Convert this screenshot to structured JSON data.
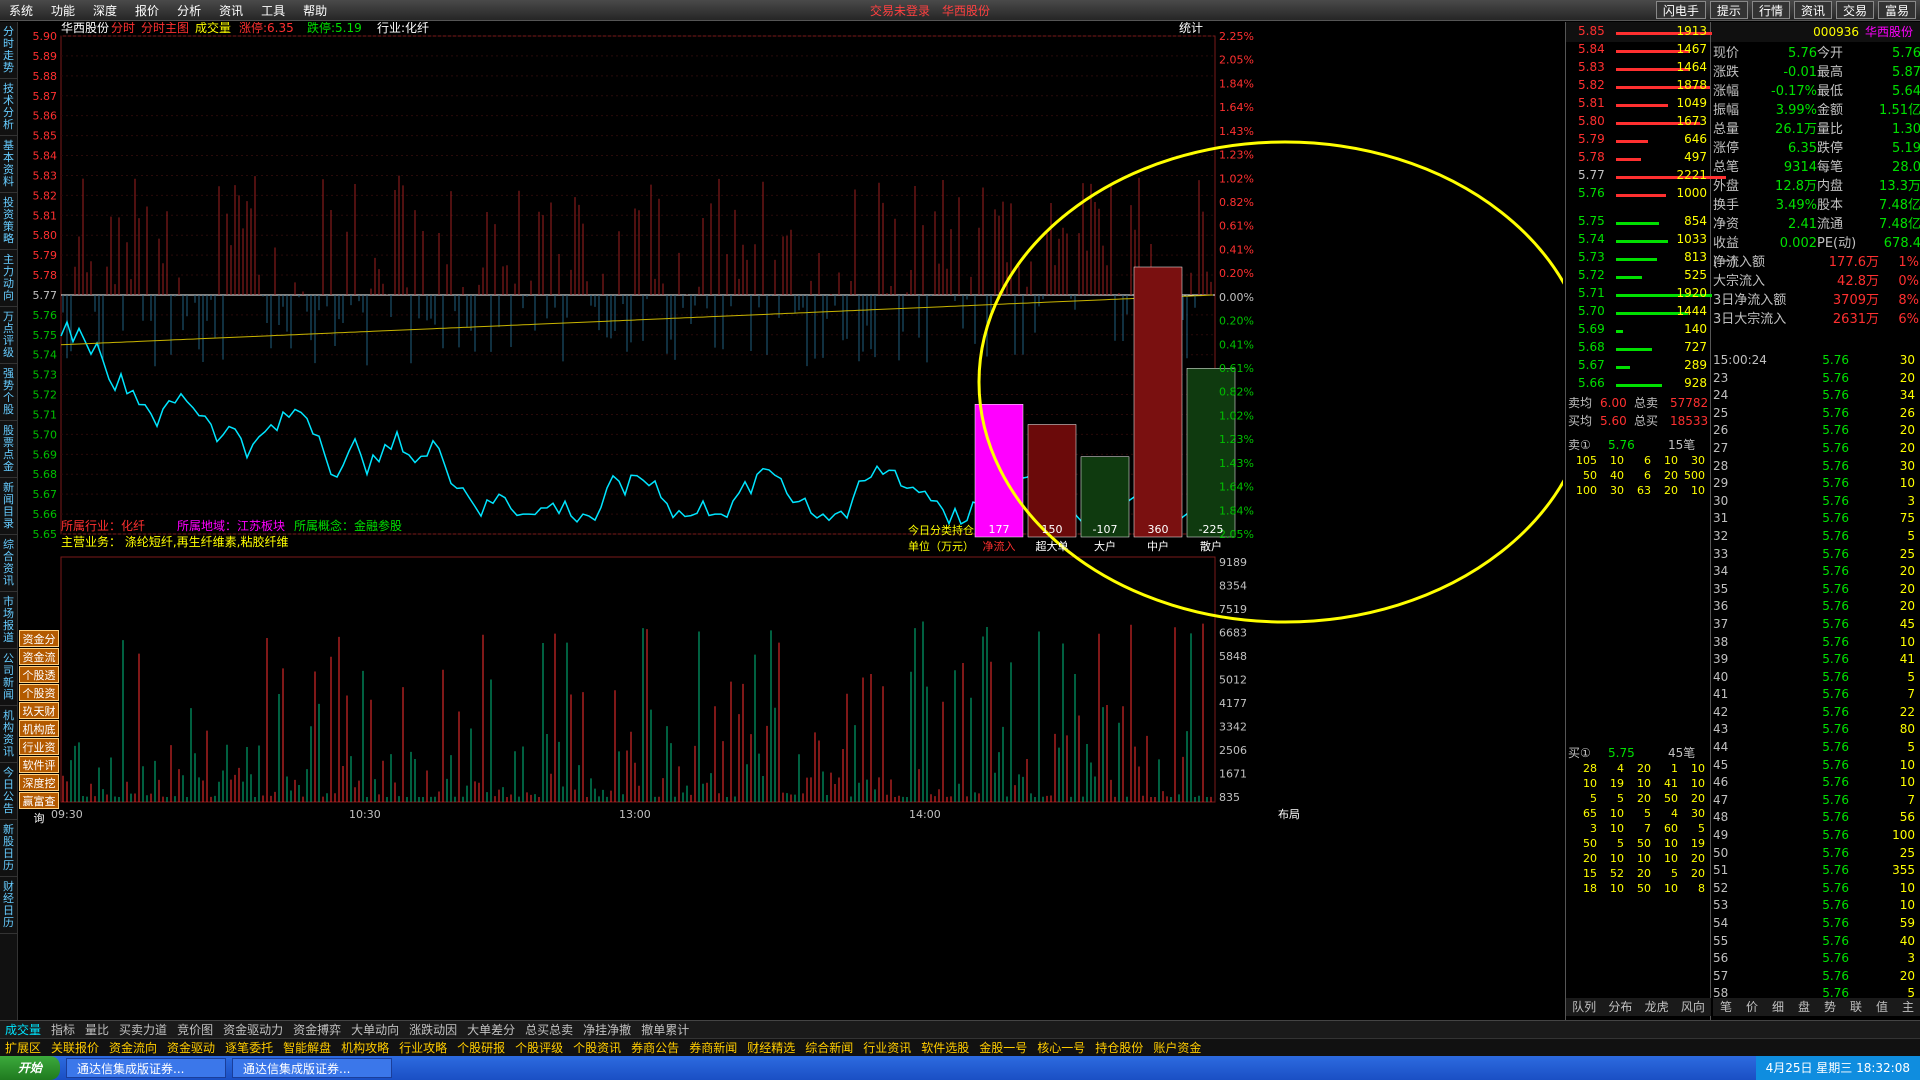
{
  "menu": [
    "系统",
    "功能",
    "深度",
    "报价",
    "分析",
    "资讯",
    "工具",
    "帮助"
  ],
  "status_center": [
    "交易未登录",
    "华西股份"
  ],
  "top_buttons": [
    "闪电手",
    "提示",
    "行情",
    "资讯",
    "交易",
    "富易"
  ],
  "left_nav": [
    "分时走势",
    "技术分析",
    "基本资料",
    "投资策略",
    "主力动向",
    "万点评级",
    "强势个股",
    "股票点金",
    "新闻目录",
    "综合资讯",
    "市场报道",
    "公司新闻",
    "机构资讯",
    "今日公告",
    "新股日历",
    "财经日历"
  ],
  "header": {
    "name": "华西股份",
    "labels": [
      "分时",
      "分时主图",
      "成交量"
    ],
    "limitup": "涨停:6.35",
    "limitdown": "跌停:5.19",
    "industry": "行业:化纤",
    "stat": "统计"
  },
  "price_ticks": [
    "5.90",
    "5.89",
    "5.88",
    "5.87",
    "5.86",
    "5.85",
    "5.84",
    "5.83",
    "5.82",
    "5.81",
    "5.80",
    "5.79",
    "5.78",
    "5.77",
    "5.76",
    "5.75",
    "5.74",
    "5.73",
    "5.72",
    "5.71",
    "5.70",
    "5.69",
    "5.68",
    "5.67",
    "5.66",
    "5.65"
  ],
  "pct_ticks": [
    "2.25%",
    "2.05%",
    "1.84%",
    "1.64%",
    "1.43%",
    "1.23%",
    "1.02%",
    "0.82%",
    "0.61%",
    "0.41%",
    "0.20%",
    "0.00%",
    "0.20%",
    "0.41%",
    "0.61%",
    "0.82%",
    "1.02%",
    "1.23%",
    "1.43%",
    "1.64%",
    "1.84%",
    "2.05%"
  ],
  "vol_ticks": [
    "9189",
    "8354",
    "7519",
    "6683",
    "5848",
    "5012",
    "4177",
    "3342",
    "2506",
    "1671",
    "835"
  ],
  "time_ticks": [
    "09:30",
    "10:30",
    "13:00",
    "14:00"
  ],
  "info": {
    "industry": "所属行业：化纤",
    "region": "所属地域：江苏板块",
    "concept": "所属概念：金融参股",
    "business": "主营业务： 涤纶短纤,再生纤维素,粘胶纤维"
  },
  "chart_data": {
    "type": "bar",
    "title": "今日分类持仓",
    "unit": "单位（万元）",
    "categories": [
      "净流入",
      "超大单",
      "大户",
      "中户",
      "散户"
    ],
    "values": [
      177,
      150,
      -107,
      360,
      -225
    ],
    "colors": [
      "#ff00ff",
      "#6b0a0a",
      "#0f3a0f",
      "#7a1010",
      "#0f3a0f"
    ]
  },
  "side_buttons": [
    "资金分析",
    "资金流向",
    "个股透视",
    "个股资料",
    "玖天财富",
    "机构底牌",
    "行业资金",
    "软件评股",
    "深度挖掘",
    "赢富查询"
  ],
  "right": {
    "code": "000936",
    "name": "华西股份",
    "sell": [
      [
        "5.85",
        "1913"
      ],
      [
        "5.84",
        "1467"
      ],
      [
        "5.83",
        "1464"
      ],
      [
        "5.82",
        "1878"
      ],
      [
        "5.81",
        "1049"
      ],
      [
        "5.80",
        "1673"
      ],
      [
        "5.79",
        "646"
      ],
      [
        "5.78",
        "497"
      ],
      [
        "5.77",
        "2221"
      ],
      [
        "5.76",
        "1000"
      ]
    ],
    "buy": [
      [
        "5.75",
        "854"
      ],
      [
        "5.74",
        "1033"
      ],
      [
        "5.73",
        "813"
      ],
      [
        "5.72",
        "525"
      ],
      [
        "5.71",
        "1920"
      ],
      [
        "5.70",
        "1444"
      ],
      [
        "5.69",
        "140"
      ],
      [
        "5.68",
        "727"
      ],
      [
        "5.67",
        "289"
      ],
      [
        "5.66",
        "928"
      ]
    ],
    "stats": [
      [
        "现价",
        "5.76",
        "今开",
        "5.76"
      ],
      [
        "涨跌",
        "-0.01",
        "最高",
        "5.87"
      ],
      [
        "涨幅",
        "-0.17%",
        "最低",
        "5.64"
      ],
      [
        "振幅",
        "3.99%",
        "金额",
        "1.51亿"
      ],
      [
        "总量",
        "26.1万",
        "量比",
        "1.30"
      ],
      [
        "涨停",
        "6.35",
        "跌停",
        "5.19"
      ],
      [
        "总笔",
        "9314",
        "每笔",
        "28.0"
      ],
      [
        "外盘",
        "12.8万",
        "内盘",
        "13.3万"
      ],
      [
        "换手",
        "3.49%",
        "股本",
        "7.48亿"
      ],
      [
        "净资",
        "2.41",
        "流通",
        "7.48亿"
      ],
      [
        "收益(一)",
        "0.002",
        "PE(动)",
        "678.4"
      ]
    ],
    "flows": [
      [
        "净流入额",
        "177.6万",
        "1%"
      ],
      [
        "大宗流入",
        "42.8万",
        "0%"
      ],
      [
        "3日净流入额",
        "3709万",
        "8%"
      ],
      [
        "3日大宗流入",
        "2631万",
        "6%"
      ]
    ],
    "avg": [
      [
        "卖均",
        "6.00",
        "总卖",
        "57782"
      ],
      [
        "买均",
        "5.60",
        "总买",
        "18533"
      ]
    ],
    "sell1": {
      "label": "卖①",
      "price": "5.76",
      "count": "15笔"
    },
    "sell1_rows": [
      [
        "105",
        "10",
        "6",
        "10",
        "30"
      ],
      [
        "50",
        "40",
        "6",
        "20",
        "500"
      ],
      [
        "100",
        "30",
        "63",
        "20",
        "10"
      ]
    ],
    "buy1": {
      "label": "买①",
      "price": "5.75",
      "count": "45笔"
    },
    "buy1_rows": [
      [
        "28",
        "4",
        "20",
        "1",
        "10"
      ],
      [
        "10",
        "19",
        "10",
        "41",
        "10"
      ],
      [
        "5",
        "5",
        "20",
        "50",
        "20"
      ],
      [
        "65",
        "10",
        "5",
        "4",
        "30"
      ],
      [
        "3",
        "10",
        "7",
        "60",
        "5"
      ],
      [
        "50",
        "5",
        "50",
        "10",
        "19"
      ],
      [
        "20",
        "10",
        "10",
        "10",
        "20"
      ],
      [
        "15",
        "52",
        "20",
        "5",
        "20"
      ],
      [
        "18",
        "10",
        "50",
        "10",
        "8"
      ]
    ],
    "ticks": [
      [
        "15:00:24",
        "5.76",
        "30"
      ],
      [
        "23",
        "5.76",
        "20"
      ],
      [
        "24",
        "5.76",
        "34"
      ],
      [
        "25",
        "5.76",
        "26"
      ],
      [
        "26",
        "5.76",
        "20"
      ],
      [
        "27",
        "5.76",
        "20"
      ],
      [
        "28",
        "5.76",
        "30"
      ],
      [
        "29",
        "5.76",
        "10"
      ],
      [
        "30",
        "5.76",
        "3"
      ],
      [
        "31",
        "5.76",
        "75"
      ],
      [
        "32",
        "5.76",
        "5"
      ],
      [
        "33",
        "5.76",
        "25"
      ],
      [
        "34",
        "5.76",
        "20"
      ],
      [
        "35",
        "5.76",
        "20"
      ],
      [
        "36",
        "5.76",
        "20"
      ],
      [
        "37",
        "5.76",
        "45"
      ],
      [
        "38",
        "5.76",
        "10"
      ],
      [
        "39",
        "5.76",
        "41"
      ],
      [
        "40",
        "5.76",
        "5"
      ],
      [
        "41",
        "5.76",
        "7"
      ],
      [
        "42",
        "5.76",
        "22"
      ],
      [
        "43",
        "5.76",
        "80"
      ],
      [
        "44",
        "5.76",
        "5"
      ],
      [
        "45",
        "5.76",
        "10"
      ],
      [
        "46",
        "5.76",
        "10"
      ],
      [
        "47",
        "5.76",
        "7"
      ],
      [
        "48",
        "5.76",
        "56"
      ],
      [
        "49",
        "5.76",
        "100"
      ],
      [
        "50",
        "5.76",
        "25"
      ],
      [
        "51",
        "5.76",
        "355"
      ],
      [
        "52",
        "5.76",
        "10"
      ],
      [
        "53",
        "5.76",
        "10"
      ],
      [
        "54",
        "5.76",
        "59"
      ],
      [
        "55",
        "5.76",
        "40"
      ],
      [
        "56",
        "5.76",
        "3"
      ],
      [
        "57",
        "5.76",
        "20"
      ],
      [
        "58",
        "5.76",
        "5"
      ]
    ],
    "tabs": [
      "队列",
      "分布",
      "龙虎",
      "风向"
    ],
    "tabs2": [
      "笔",
      "价",
      "细",
      "盘",
      "势",
      "联",
      "值",
      "主"
    ]
  },
  "bottom1": [
    "成交量",
    "指标",
    "量比",
    "买卖力道",
    "竞价图",
    "资金驱动力",
    "资金搏弈",
    "大单动向",
    "涨跌动因",
    "大单差分",
    "总买总卖",
    "净挂净撤",
    "撤单累计"
  ],
  "bottom2": [
    "扩展区",
    "关联报价",
    "资金流向",
    "资金驱动",
    "逐笔委托",
    "智能解盘",
    "机构攻略",
    "行业攻略",
    "个股研报",
    "个股评级",
    "个股资讯",
    "券商公告",
    "券商新闻",
    "财经精选",
    "综合新闻",
    "行业资讯",
    "软件选股",
    "金股一号",
    "核心一号",
    "持仓股份",
    "账户资金"
  ],
  "layout": "布局",
  "taskbar": {
    "start": "开始",
    "tasks": [
      "通达信集成版证券...",
      "通达信集成版证券..."
    ],
    "tray": "4月25日 星期三 18:32:08"
  }
}
